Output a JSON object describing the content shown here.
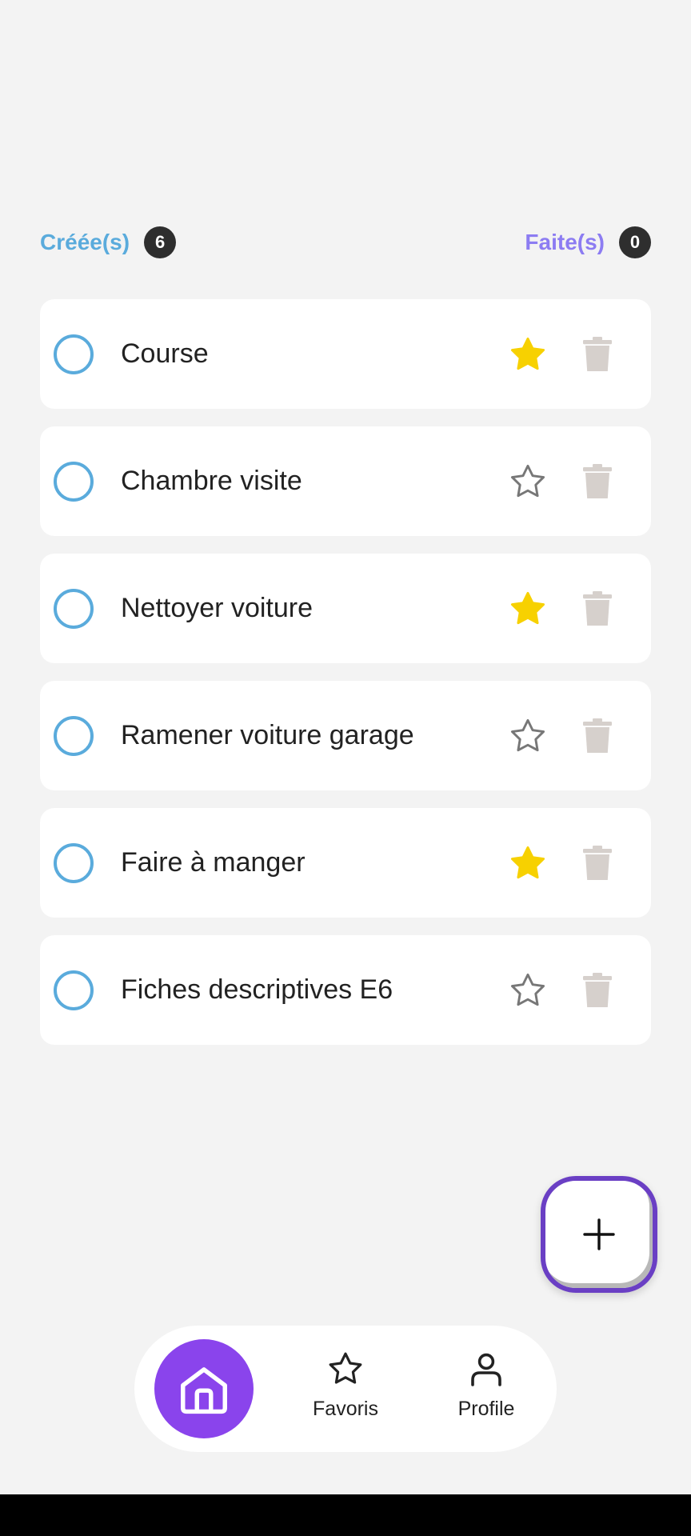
{
  "counters": {
    "created_label": "Créée(s)",
    "created_count": "6",
    "done_label": "Faite(s)",
    "done_count": "0"
  },
  "tasks": [
    {
      "title": "Course",
      "favorite": true
    },
    {
      "title": "Chambre visite",
      "favorite": false
    },
    {
      "title": "Nettoyer voiture",
      "favorite": true
    },
    {
      "title": "Ramener voiture garage",
      "favorite": false
    },
    {
      "title": "Faire à manger",
      "favorite": true
    },
    {
      "title": "Fiches descriptives E6",
      "favorite": false
    }
  ],
  "fab": {
    "icon": "plus-icon"
  },
  "nav": {
    "home_icon": "home-icon",
    "favorites_label": "Favoris",
    "profile_label": "Profile"
  },
  "colors": {
    "accent_blue": "#5aabdc",
    "accent_purple": "#8a44ec",
    "done_label": "#8c7cf2",
    "star_filled": "#f7d101",
    "trash": "#d6d0cc"
  }
}
